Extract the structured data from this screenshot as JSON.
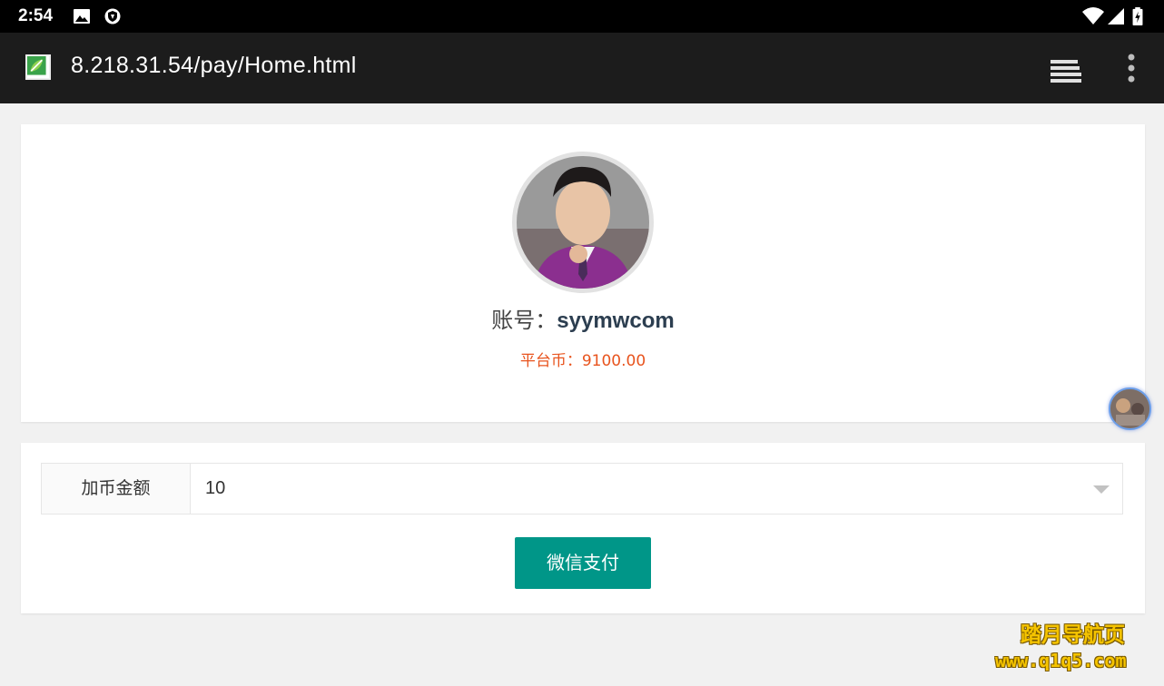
{
  "status_bar": {
    "time": "2:54",
    "icons": [
      "image-icon",
      "shield-icon",
      "wifi-icon",
      "signal-icon",
      "battery-charging-icon"
    ]
  },
  "browser": {
    "url": "8.218.31.54/pay/Home.html",
    "favicon": "leaf-favicon-icon",
    "tabs_icon": "tabs-stack-icon",
    "menu_icon": "more-vert-icon"
  },
  "profile": {
    "account_label": "账号：",
    "account_name": "syymwcom",
    "coins_label": "平台币：",
    "coins_value": "9100.00",
    "avatar": "user-avatar-photo"
  },
  "recharge": {
    "amount_label": "加币金额",
    "amount_value": "10",
    "pay_button": "微信支付"
  },
  "watermark": {
    "line1": "踏月导航页",
    "line2": "www.q1q5.com"
  },
  "colors": {
    "accent": "#009688",
    "coins": "#e8541e",
    "account": "#2c3e50",
    "browser_bar": "#1c1c1c",
    "page_bg": "#f1f1f1"
  }
}
